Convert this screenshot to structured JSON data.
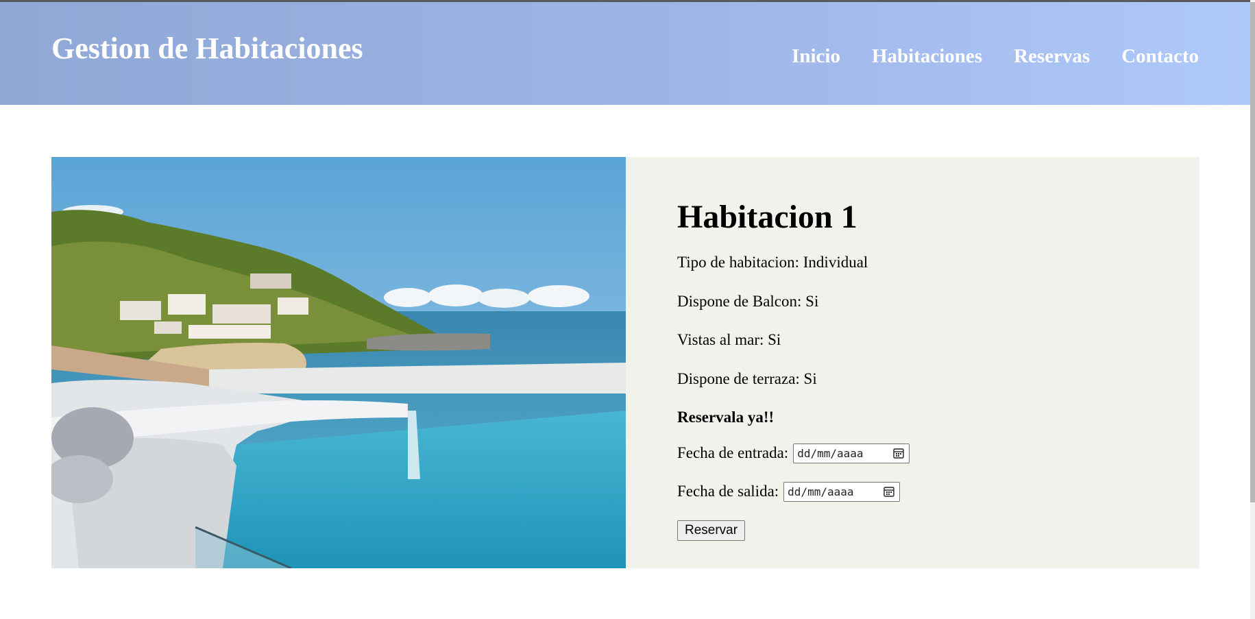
{
  "header": {
    "site_title": "Gestion de Habitaciones",
    "nav": [
      "Inicio",
      "Habitaciones",
      "Reservas",
      "Contacto"
    ]
  },
  "room": {
    "title": "Habitacion 1",
    "details": [
      "Tipo de habitacion: Individual",
      "Dispone de Balcon: Si",
      "Vistas al mar: Si",
      "Dispone de terraza: Si"
    ],
    "cta": "Reservala ya!!",
    "checkin_label": "Fecha de entrada:",
    "checkout_label": "Fecha de salida:",
    "date_placeholder": "dd/mm/aaaa",
    "submit_label": "Reservar"
  },
  "colors": {
    "header_gradient_start": "#8fa8d6",
    "header_gradient_end": "#aec9fb",
    "info_panel_bg": "#f2f2ed"
  },
  "icons": {
    "date_picker": "calendar-icon"
  }
}
